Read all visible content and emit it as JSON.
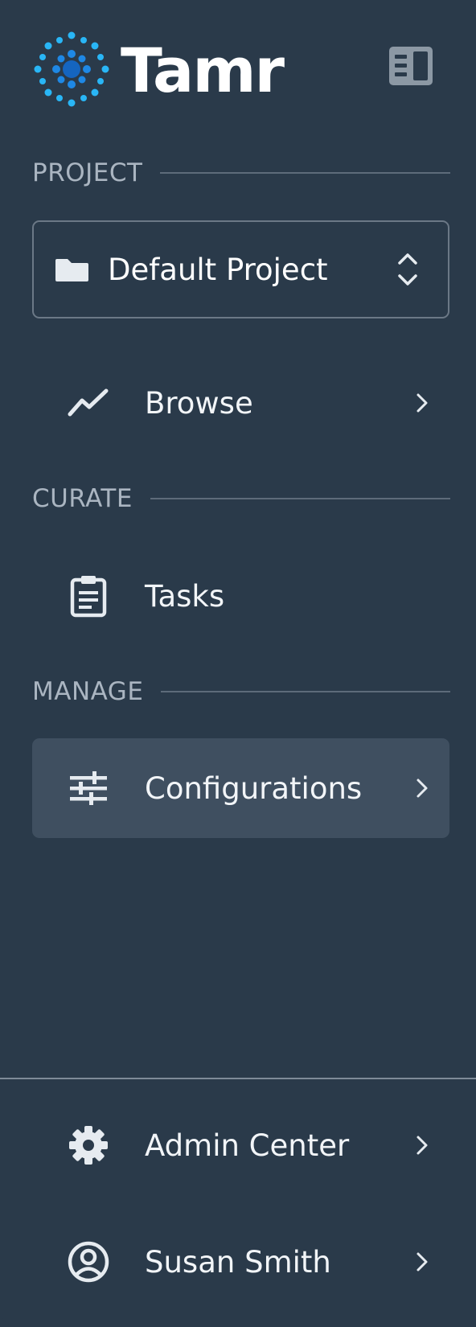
{
  "app": {
    "brand": "Tamr"
  },
  "colors": {
    "background": "#2a3a4a",
    "active": "#3f4f60",
    "accent": "#29b6f6",
    "accent_dark": "#1565c0"
  },
  "sections": {
    "project": "PROJECT",
    "curate": "CURATE",
    "manage": "MANAGE"
  },
  "project_selector": {
    "label": "Default Project",
    "icon": "folder-icon"
  },
  "nav": {
    "browse": {
      "label": "Browse",
      "icon": "trend-line-icon"
    },
    "tasks": {
      "label": "Tasks",
      "icon": "clipboard-icon"
    },
    "configurations": {
      "label": "Configurations",
      "icon": "sliders-icon",
      "active": true
    }
  },
  "footer": {
    "admin": {
      "label": "Admin Center",
      "icon": "gear-icon"
    },
    "user": {
      "label": "Susan Smith",
      "icon": "user-circle-icon"
    }
  }
}
